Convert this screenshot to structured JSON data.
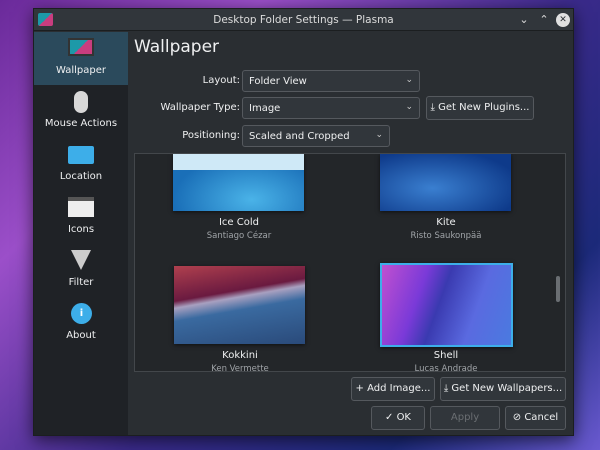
{
  "window": {
    "title": "Desktop Folder Settings — Plasma"
  },
  "sidebar": {
    "items": [
      {
        "label": "Wallpaper",
        "icon": "monitor-icon",
        "selected": true
      },
      {
        "label": "Mouse Actions",
        "icon": "mouse-icon"
      },
      {
        "label": "Location",
        "icon": "folder-icon"
      },
      {
        "label": "Icons",
        "icon": "icons-view-icon"
      },
      {
        "label": "Filter",
        "icon": "filter-icon"
      },
      {
        "label": "About",
        "icon": "info-icon"
      }
    ]
  },
  "main": {
    "title": "Wallpaper",
    "layout": {
      "label": "Layout:",
      "value": "Folder View"
    },
    "type": {
      "label": "Wallpaper Type:",
      "value": "Image"
    },
    "get_plugins": "Get New Plugins...",
    "positioning": {
      "label": "Positioning:",
      "value": "Scaled and Cropped"
    },
    "wallpapers": [
      {
        "name": "Ice Cold",
        "author": "Santiago Cézar"
      },
      {
        "name": "Kite",
        "author": "Risto Saukonpää"
      },
      {
        "name": "Kokkini",
        "author": "Ken Vermette"
      },
      {
        "name": "Shell",
        "author": "Lucas Andrade",
        "selected": true
      }
    ],
    "add_image": "Add Image...",
    "get_wallpapers": "Get New Wallpapers..."
  },
  "footer": {
    "ok": "OK",
    "apply": "Apply",
    "cancel": "Cancel"
  },
  "colors": {
    "accent": "#3daee9",
    "selection": "#2b4a5c"
  }
}
